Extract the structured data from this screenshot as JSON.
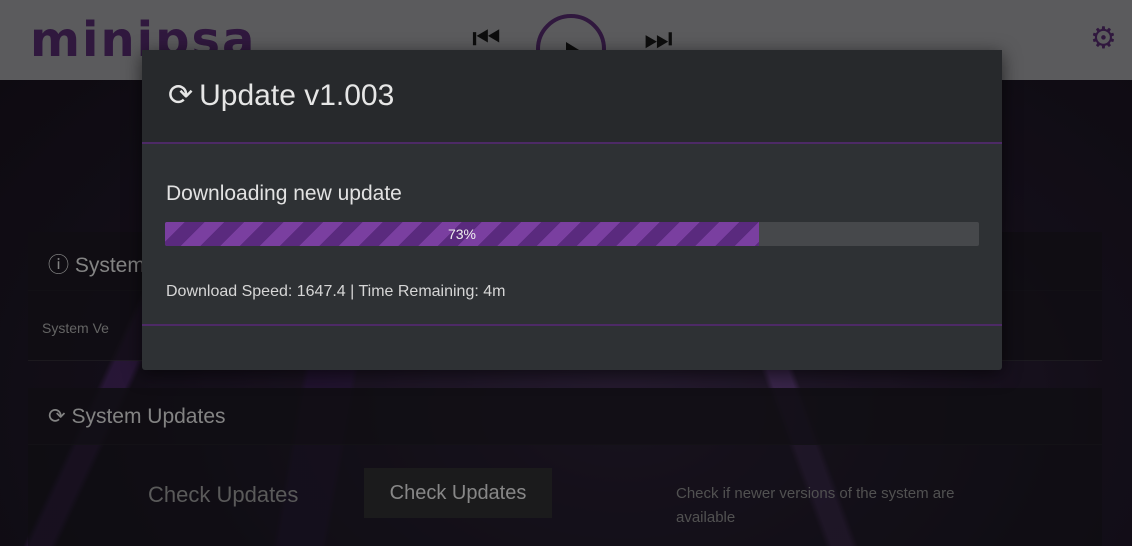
{
  "app": {
    "logo_text": "minipsa",
    "colors": {
      "brand": "#4a2560",
      "accent": "#7a3fa0",
      "topbar": "#8d8d8f"
    }
  },
  "player": {
    "prev_icon": "skip-previous-icon",
    "play_icon": "play-icon",
    "next_icon": "skip-next-icon",
    "settings_icon": "gear-icon"
  },
  "background": {
    "system_info_title": "System",
    "system_version_label": "System Ve",
    "system_updates_title": "System Updates",
    "check_updates_label": "Check Updates",
    "check_updates_button": "Check Updates",
    "check_updates_desc": "Check if newer versions of the system are available"
  },
  "modal": {
    "title": "Update v1.003",
    "title_icon": "refresh-icon",
    "status": "Downloading new update",
    "progress_percent": 73,
    "progress_label": "73%",
    "speed_text": "Download Speed: 1647.4 | Time Remaining: 4m"
  }
}
